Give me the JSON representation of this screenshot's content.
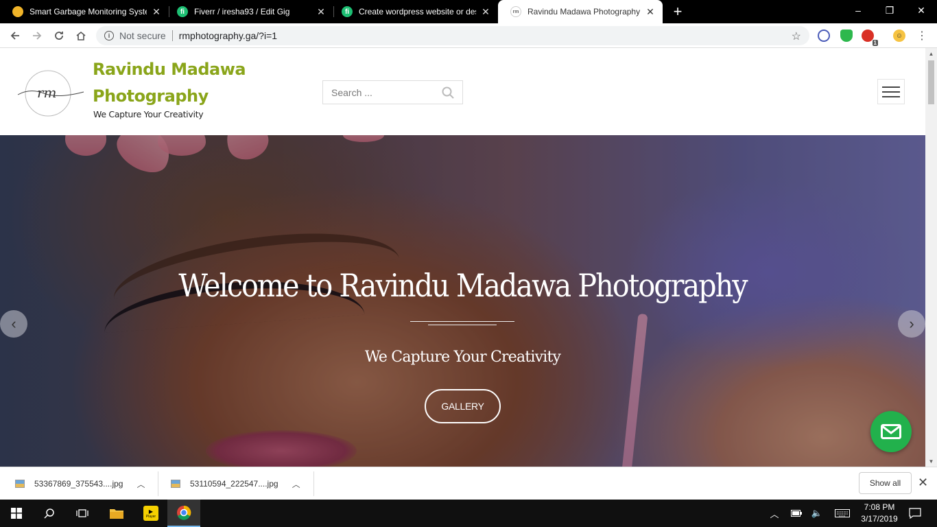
{
  "browser": {
    "tabs": [
      {
        "title": "Smart Garbage Monitoring Syste",
        "favicon_color": "#f0b429",
        "active": false
      },
      {
        "title": "Fiverr / iresha93 / Edit Gig",
        "favicon_color": "#1dbf73",
        "active": false
      },
      {
        "title": "Create wordpress website or des",
        "favicon_color": "#1dbf73",
        "active": false
      },
      {
        "title": "Ravindu Madawa Photography –",
        "favicon_color": "#ffffff",
        "active": true
      }
    ],
    "new_tab": "+",
    "window_controls": {
      "minimize": "–",
      "restore": "❐",
      "close": "✕"
    },
    "address": {
      "security_label": "Not secure",
      "url": "rmphotography.ga/?i=1"
    },
    "extension_badge": "1"
  },
  "site": {
    "logo_text": "rm",
    "title_line1": "Ravindu Madawa",
    "title_line2": "Photography",
    "tagline": "We Capture Your Creativity",
    "search_placeholder": "Search ...",
    "brand_color": "#8aa51a"
  },
  "hero": {
    "title": "Welcome to Ravindu Madawa Photography",
    "subtitle": "We Capture Your Creativity",
    "button_label": "GALLERY",
    "prev_arrow": "‹",
    "next_arrow": "›"
  },
  "downloads": {
    "items": [
      {
        "name": "53367869_375543....jpg"
      },
      {
        "name": "53110594_222547....jpg"
      }
    ],
    "show_all": "Show all"
  },
  "taskbar": {
    "time": "7:08 PM",
    "date": "3/17/2019",
    "player_label": "Player"
  }
}
